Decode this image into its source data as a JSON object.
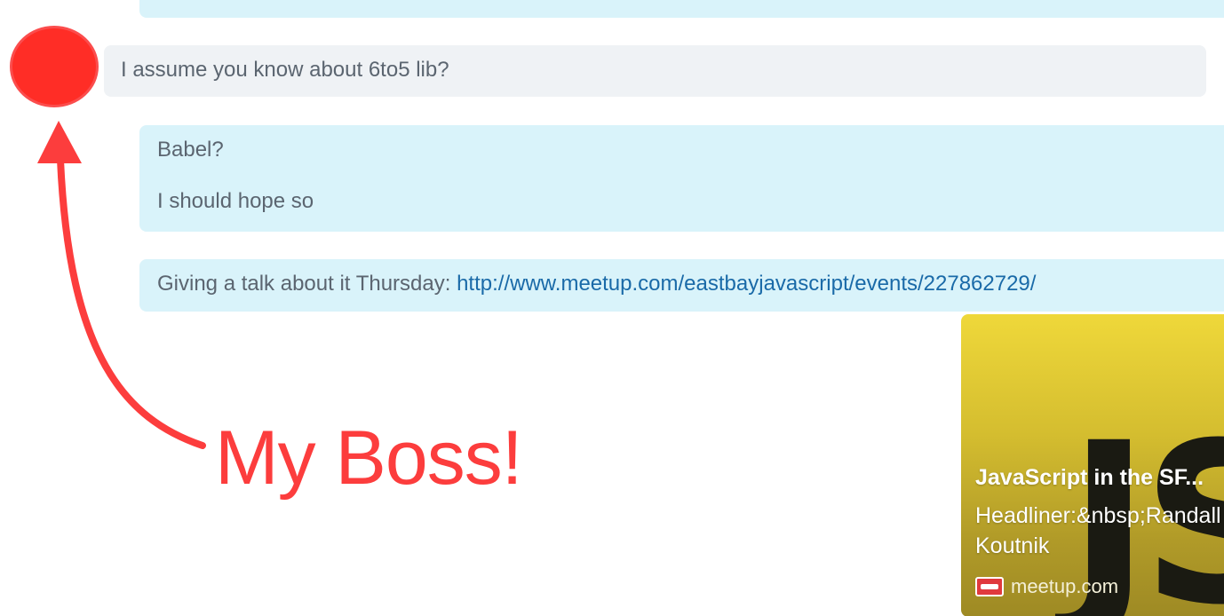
{
  "messages": {
    "boss_question": "I assume you know about 6to5 lib?",
    "reply_line1": "Babel?",
    "reply_line2": "I should hope so",
    "talk_prefix": "Giving a talk about it Thursday: ",
    "talk_link": "http://www.meetup.com/eastbayjavascript/events/227862729/"
  },
  "link_preview": {
    "title": "JavaScript in the SF...",
    "description": "Headliner:&nbsp;Randall Koutnik",
    "source": "meetup.com",
    "image_text": "JS",
    "favicon_icon": "meetup-icon"
  },
  "annotation": {
    "label": "My Boss!",
    "color": "#fc3d3d",
    "icon": "arrow-up-icon"
  },
  "colors": {
    "own_bubble": "#d9f3fa",
    "other_bubble": "#eff2f5",
    "avatar": "#ff2d26",
    "link": "#1a6aa8"
  }
}
